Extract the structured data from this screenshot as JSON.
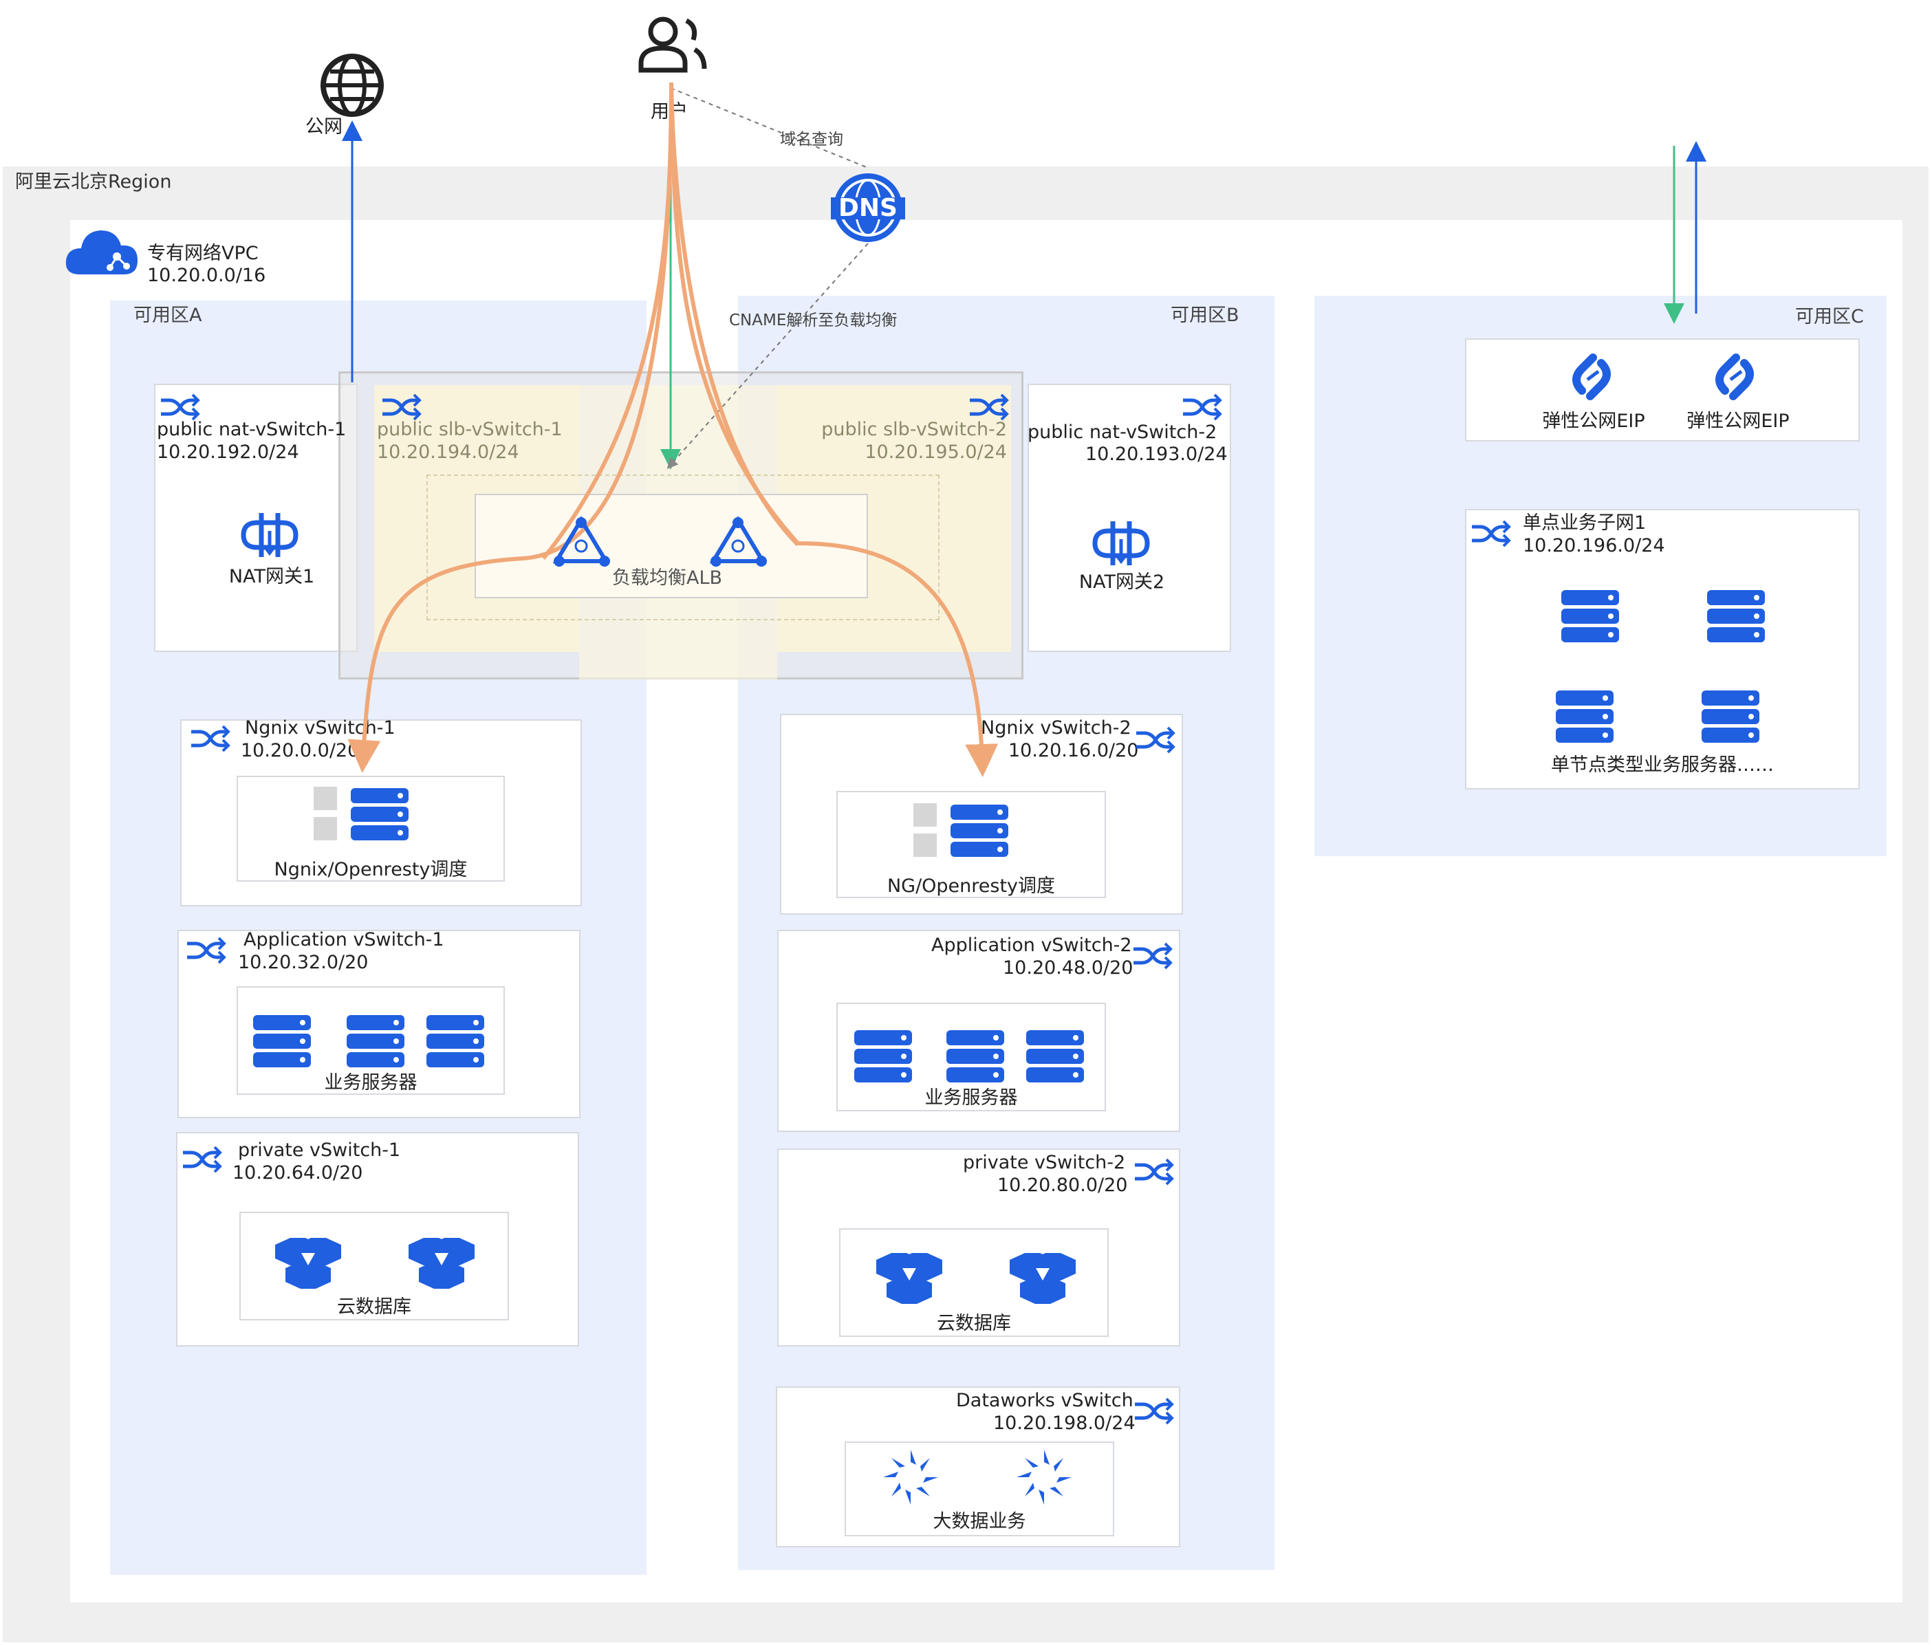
{
  "top": {
    "internet_label": "公网",
    "user_label": "用户",
    "dns_query_label": "域名查询",
    "dns_icon_text": "DNS",
    "cname_label": "CNAME解析至负载均衡"
  },
  "region": {
    "label": "阿里云北京Region"
  },
  "vpc": {
    "name": "专有网络VPC",
    "cidr": "10.20.0.0/16"
  },
  "zones": {
    "a": "可用区A",
    "b": "可用区B",
    "c": "可用区C"
  },
  "nat1": {
    "name": "public nat-vSwitch-1",
    "cidr": "10.20.192.0/24",
    "gateway": "NAT网关1"
  },
  "nat2": {
    "name": "public nat-vSwitch-2",
    "cidr": "10.20.193.0/24",
    "gateway": "NAT网关2"
  },
  "slb1": {
    "name": "public slb-vSwitch-1",
    "cidr": "10.20.194.0/24"
  },
  "slb2": {
    "name": "public slb-vSwitch-2",
    "cidr": "10.20.195.0/24"
  },
  "alb": {
    "label": "负载均衡ALB"
  },
  "ngnix1": {
    "name": "Ngnix vSwitch-1",
    "cidr": "10.20.0.0/20",
    "content": "Ngnix/Openresty调度"
  },
  "ngnix2": {
    "name": "Ngnix vSwitch-2",
    "cidr": "10.20.16.0/20",
    "content": "NG/Openresty调度"
  },
  "app1": {
    "name": "Application vSwitch-1",
    "cidr": "10.20.32.0/20",
    "content": "业务服务器"
  },
  "app2": {
    "name": "Application vSwitch-2",
    "cidr": "10.20.48.0/20",
    "content": "业务服务器"
  },
  "priv1": {
    "name": "private vSwitch-1",
    "cidr": "10.20.64.0/20",
    "content": "云数据库"
  },
  "priv2": {
    "name": "private vSwitch-2",
    "cidr": "10.20.80.0/20",
    "content": "云数据库"
  },
  "dataworks": {
    "name": "Dataworks vSwitch",
    "cidr": "10.20.198.0/24",
    "content": "大数据业务"
  },
  "eip": {
    "label1": "弹性公网EIP",
    "label2": "弹性公网EIP"
  },
  "single": {
    "name": "单点业务子网1",
    "cidr": "10.20.196.0/24",
    "content": "单节点类型业务服务器……"
  },
  "colors": {
    "blue": "#1f5fe0",
    "orange": "#f0a878",
    "green": "#3fbf86",
    "region_bg": "#efefef",
    "zone_bg": "#e9effd"
  }
}
